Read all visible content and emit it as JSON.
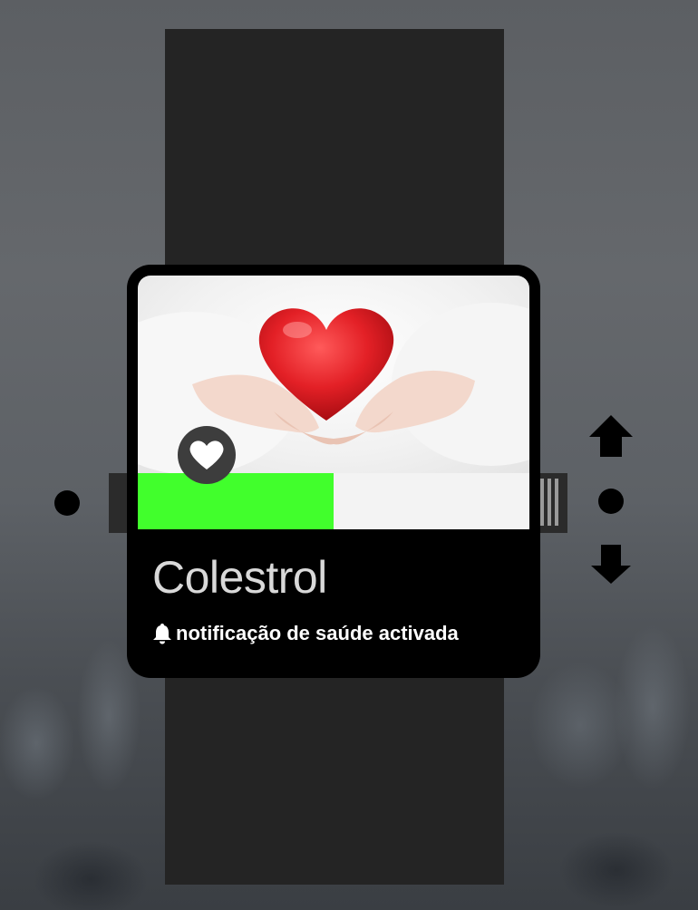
{
  "item": {
    "title": "Colestrol",
    "notification": "notificação de saúde activada",
    "progress_fraction": 0.5,
    "progress_color": "#41ff2c",
    "image": "heart-in-hands"
  },
  "icons": {
    "favorite": "heart-icon",
    "notification": "bell-icon",
    "up": "arrow-up-icon",
    "down": "arrow-down-icon"
  }
}
